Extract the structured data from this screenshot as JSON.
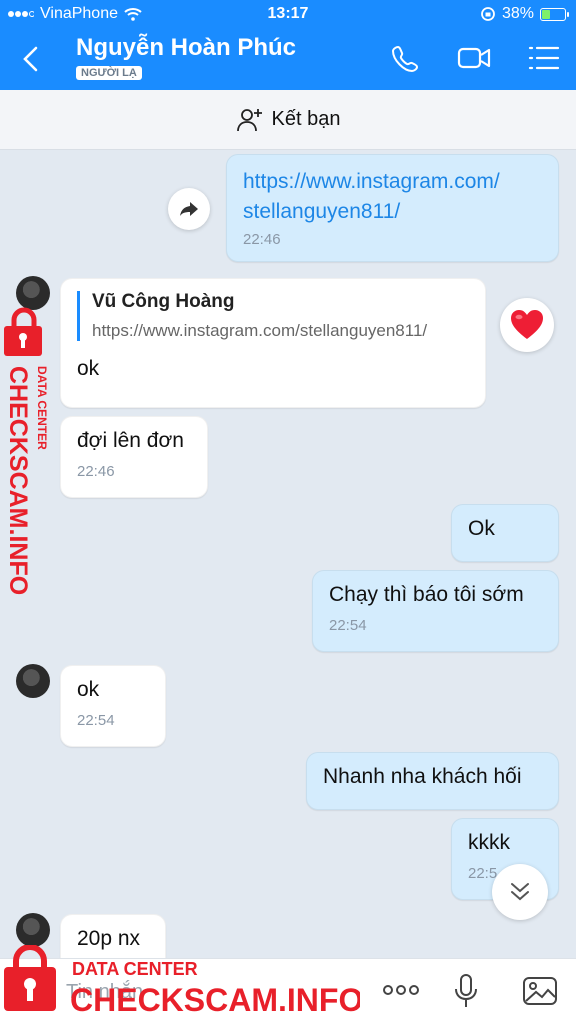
{
  "status_bar": {
    "carrier": "VinaPhone",
    "time": "13:17",
    "battery": "38%",
    "battery_level": 0.38
  },
  "header": {
    "contact_name": "Nguyễn Hoàn Phúc",
    "tag": "NGƯỜI LẠ"
  },
  "friend_bar": {
    "label": "Kết bạn"
  },
  "messages": [
    {
      "side": "me",
      "link_line1": "https://www.instagram.com/",
      "link_line2": "stellanguyen811/",
      "time": "22:46"
    },
    {
      "side": "them",
      "quote_name": "Vũ Công Hoàng",
      "quote_text": "https://www.instagram.com/stellanguyen811/",
      "text": "ok",
      "reaction": "heart"
    },
    {
      "side": "them",
      "text": "đợi lên đơn",
      "time": "22:46"
    },
    {
      "side": "me",
      "text": "Ok"
    },
    {
      "side": "me",
      "text": "Chạy thì báo tôi sớm",
      "time": "22:54"
    },
    {
      "side": "them",
      "text": "ok",
      "time": "22:54"
    },
    {
      "side": "me",
      "text": "Nhanh nha khách hối"
    },
    {
      "side": "me",
      "text": "kkkk",
      "time": "22:5"
    },
    {
      "side": "them",
      "text": "20p nx"
    }
  ],
  "input": {
    "placeholder": "Tin nhắn"
  },
  "watermark": {
    "line1": "DATA CENTER",
    "line2": "CHECKSCAM.INFO"
  },
  "colors": {
    "brand": "#1a8cff",
    "my_bubble": "#d4ecfd",
    "watermark_red": "#e8202a"
  }
}
